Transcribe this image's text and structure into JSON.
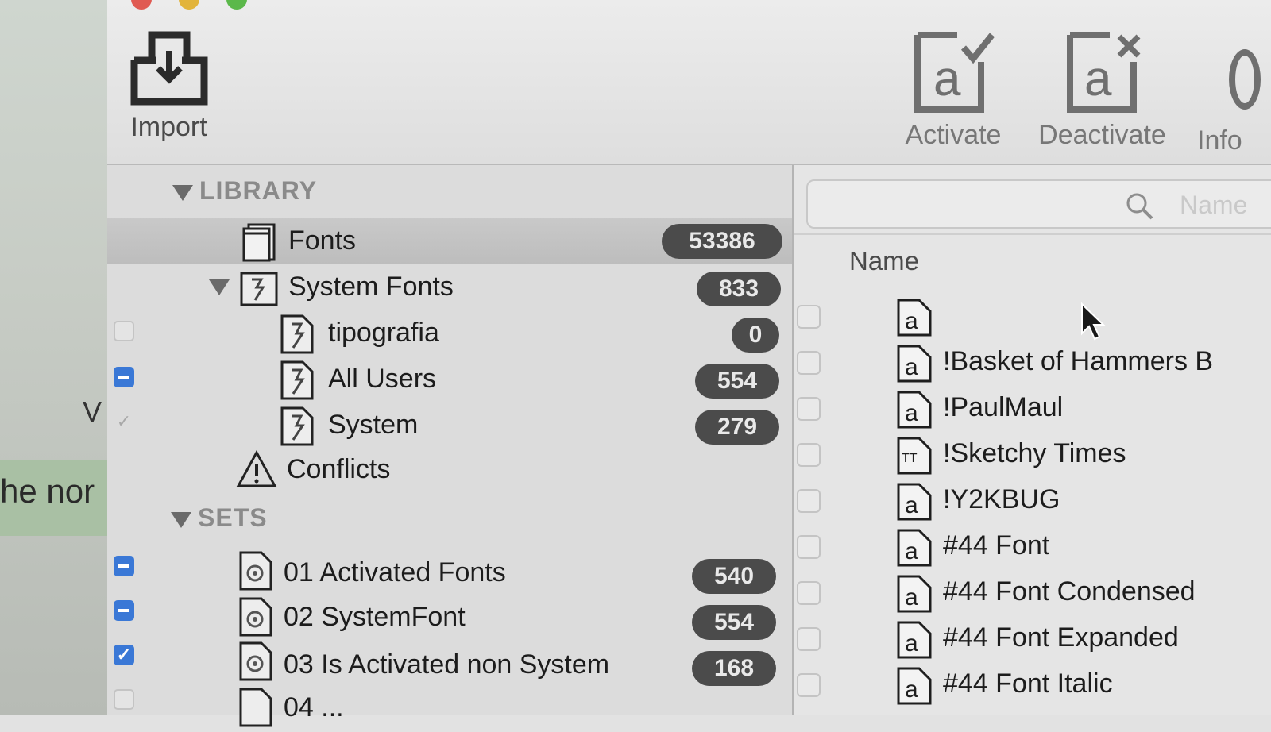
{
  "background_window": {
    "partial_letter": "V",
    "partial_text": "he nor"
  },
  "toolbar": {
    "import_label": "Import",
    "activate_label": "Activate",
    "deactivate_label": "Deactivate",
    "info_label": "Info"
  },
  "sidebar": {
    "library_header": "LIBRARY",
    "sets_header": "SETS",
    "library_items": [
      {
        "label": "Fonts",
        "count": "53386"
      },
      {
        "label": "System Fonts",
        "count": "833"
      },
      {
        "label": "tipografia",
        "count": "0"
      },
      {
        "label": "All Users",
        "count": "554"
      },
      {
        "label": "System",
        "count": "279"
      },
      {
        "label": "Conflicts"
      }
    ],
    "sets_items": [
      {
        "label": "01 Activated Fonts",
        "count": "540"
      },
      {
        "label": "02 SystemFont",
        "count": "554"
      },
      {
        "label": "03 Is Activated non System",
        "count": "168"
      },
      {
        "label": "04 ..."
      }
    ]
  },
  "right_pane": {
    "search_placeholder": "Name",
    "column_name": "Name",
    "fonts": [
      {
        "name": "",
        "icon": "font-file-icon"
      },
      {
        "name": "!Basket of Hammers B",
        "icon": "font-file-icon"
      },
      {
        "name": "!PaulMaul",
        "icon": "font-file-icon"
      },
      {
        "name": "!Sketchy Times",
        "icon": "truetype-file-icon"
      },
      {
        "name": "!Y2KBUG",
        "icon": "font-file-icon"
      },
      {
        "name": "#44 Font",
        "icon": "font-file-icon"
      },
      {
        "name": "#44 Font Condensed",
        "icon": "font-file-icon"
      },
      {
        "name": "#44 Font Expanded",
        "icon": "font-file-icon"
      },
      {
        "name": "#44 Font Italic",
        "icon": "font-file-icon"
      }
    ]
  },
  "colors": {
    "badge": "#4b4b4b",
    "checkbox_blue": "#3a78d6",
    "selection": "#c4c4c4"
  }
}
